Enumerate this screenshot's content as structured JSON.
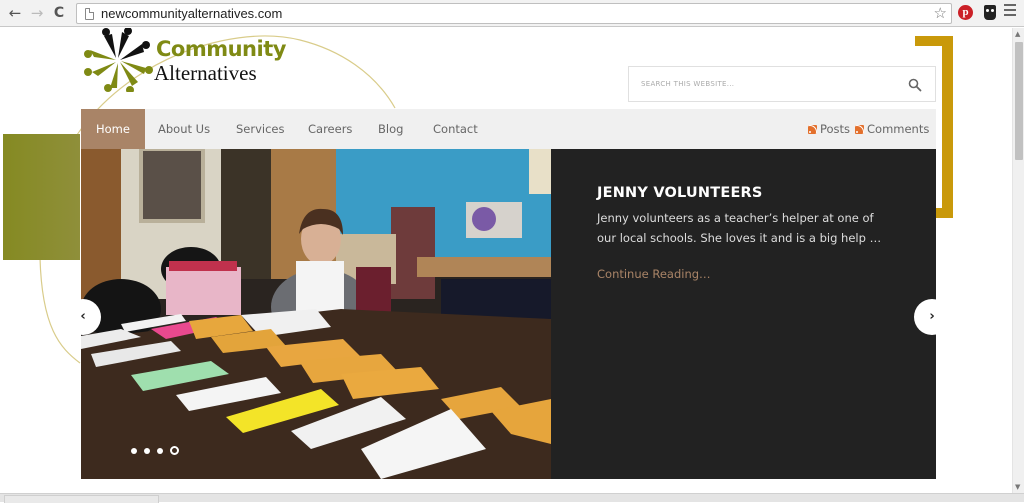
{
  "browser": {
    "url": "newcommunityalternatives.com",
    "back_icon": "arrow-left-icon",
    "forward_icon": "arrow-right-icon",
    "reload_icon": "reload-icon",
    "back_glyph": "←",
    "forward_glyph": "→",
    "reload_glyph": "C",
    "bookmark_glyph": "☆",
    "pinterest_glyph": "p",
    "extensions": [
      "pinterest-icon",
      "owl-icon"
    ]
  },
  "site": {
    "logo": {
      "line1": "Community",
      "line2": "Alternatives"
    },
    "colors": {
      "olive": "#858a22",
      "gold": "#c9990a",
      "accent": "#a98467",
      "dark": "#222222"
    },
    "search": {
      "placeholder": "SEARCH THIS WEBSITE..."
    },
    "nav": {
      "items": [
        {
          "label": "Home",
          "active": true
        },
        {
          "label": "About Us",
          "active": false
        },
        {
          "label": "Services",
          "active": false
        },
        {
          "label": "Careers",
          "active": false
        },
        {
          "label": "Blog",
          "active": false
        },
        {
          "label": "Contact",
          "active": false
        }
      ],
      "rss": [
        {
          "label": "Posts"
        },
        {
          "label": "Comments"
        }
      ]
    },
    "slider": {
      "title": "JENNY VOLUNTEERS",
      "text": "Jenny volunteers as a teacher’s helper at one of our local schools. She loves it and is a big help …",
      "link": "Continue Reading…",
      "prev_glyph": "‹",
      "next_glyph": "›",
      "slide_count": 4,
      "active_slide": 4
    }
  }
}
